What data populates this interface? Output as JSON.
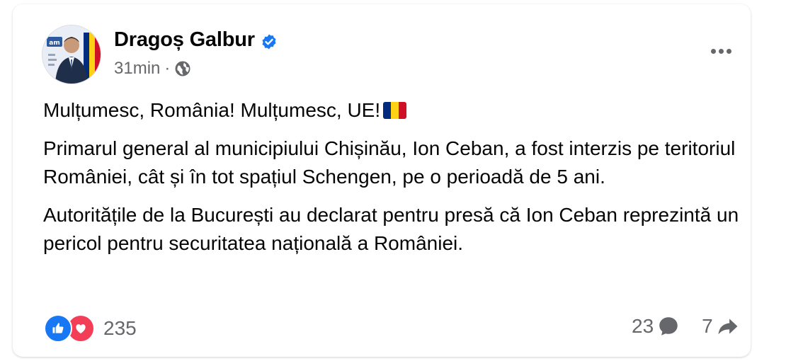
{
  "author": {
    "name": "Dragoș Galbur",
    "verified": true
  },
  "meta": {
    "time": "31min",
    "separator": "·",
    "audience_icon": "globe-icon"
  },
  "post": {
    "paragraphs": [
      "Mulțumesc, România! Mulțumesc, UE!",
      "Primarul general al municipiului Chișinău, Ion Ceban, a fost interzis pe teritoriul României, cât și în tot spațiul Schengen, pe o perioadă de 5 ani.",
      "Autoritățile de la București au declarat pentru presă că Ion Ceban reprezintă un pericol pentru securitatea națională a României."
    ],
    "flag_colors": [
      "#002B7F",
      "#FCD116",
      "#CE1126"
    ]
  },
  "footer": {
    "reactions_count": "235",
    "comments_count": "23",
    "shares_count": "7"
  },
  "colors": {
    "like": "#1877f2",
    "love": "#f33e58",
    "verified": "#1877f2",
    "secondary_text": "#65676b"
  }
}
